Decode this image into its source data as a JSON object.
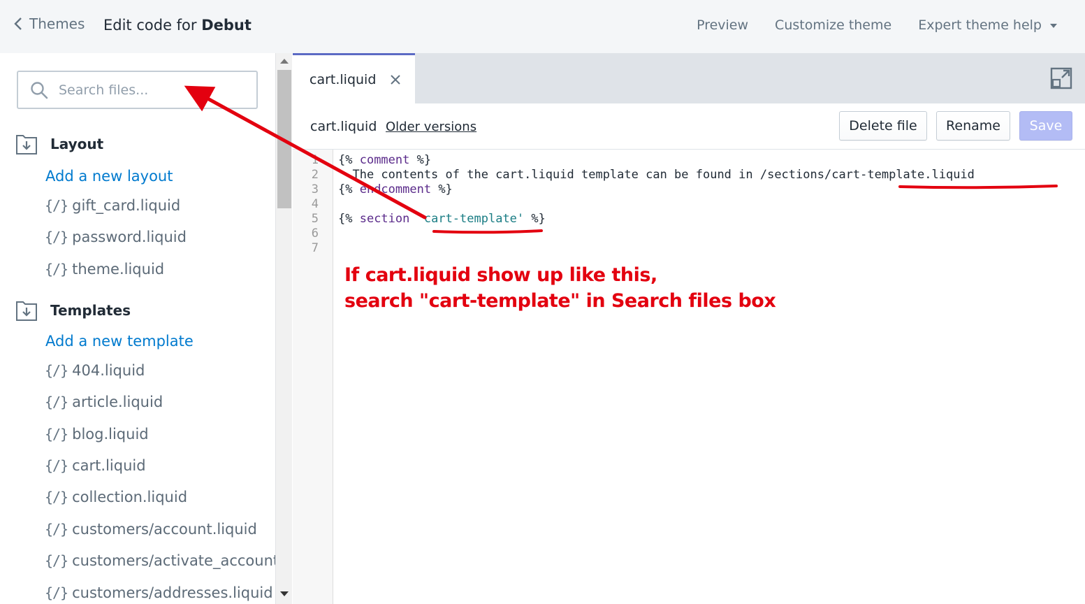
{
  "header": {
    "back_label": "Themes",
    "title_prefix": "Edit code for ",
    "theme_name": "Debut",
    "links": {
      "preview": "Preview",
      "customize": "Customize theme",
      "help": "Expert theme help"
    }
  },
  "sidebar": {
    "search_placeholder": "Search files...",
    "sections": [
      {
        "title": "Layout",
        "add_label": "Add a new layout",
        "files": [
          "gift_card.liquid",
          "password.liquid",
          "theme.liquid"
        ]
      },
      {
        "title": "Templates",
        "add_label": "Add a new template",
        "files": [
          "404.liquid",
          "article.liquid",
          "blog.liquid",
          "cart.liquid",
          "collection.liquid",
          "customers/account.liquid",
          "customers/activate_account.liquid",
          "customers/addresses.liquid"
        ]
      }
    ],
    "file_icon": "{/}"
  },
  "editor": {
    "tab_label": "cart.liquid",
    "file_name": "cart.liquid",
    "older_versions": "Older versions",
    "buttons": {
      "delete": "Delete file",
      "rename": "Rename",
      "save": "Save"
    },
    "line_numbers": [
      "1",
      "2",
      "3",
      "4",
      "5",
      "6",
      "7"
    ],
    "code": {
      "l1_open": "{% ",
      "l1_kw": "comment",
      "l1_close": " %}",
      "l2": "  The contents of the cart.liquid template can be found in /sections/cart-template.liquid",
      "l3_open": "{% ",
      "l3_kw": "endcomment",
      "l3_close": " %}",
      "l5_open": "{% ",
      "l5_kw": "section",
      "l5_str": "'cart-template'",
      "l5_close": " %}"
    }
  },
  "annotation": {
    "line1": "If cart.liquid show up like this,",
    "line2": "search \"cart-template\" in Search files box",
    "color": "#e3000f"
  },
  "colors": {
    "accent": "#5c6ac4",
    "link": "#007ace",
    "save_disabled": "#b3bcf5"
  }
}
